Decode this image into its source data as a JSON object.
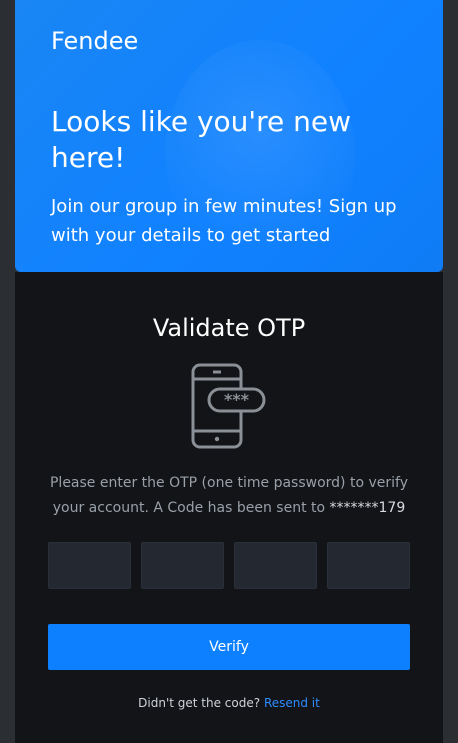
{
  "colors": {
    "hero": "#1081ff",
    "panel": "#121418",
    "input": "#232831",
    "primary": "#0d80ff",
    "link": "#2f8cff",
    "muted": "#9aa0a8"
  },
  "hero": {
    "brand": "Fendee",
    "headline": "Looks like you're new here!",
    "subtext": "Join our group in few minutes! Sign up with your details to get started"
  },
  "otp": {
    "title": "Validate OTP",
    "icon": "phone-password-icon",
    "icon_text": "***",
    "description_prefix": "Please enter the OTP (one time password) to verify your account. A Code has been sent to ",
    "masked_number": "*******179",
    "digits": [
      "",
      "",
      "",
      ""
    ],
    "verify_label": "Verify",
    "resend_prompt": "Didn't get the code?",
    "resend_link": "Resend it"
  }
}
